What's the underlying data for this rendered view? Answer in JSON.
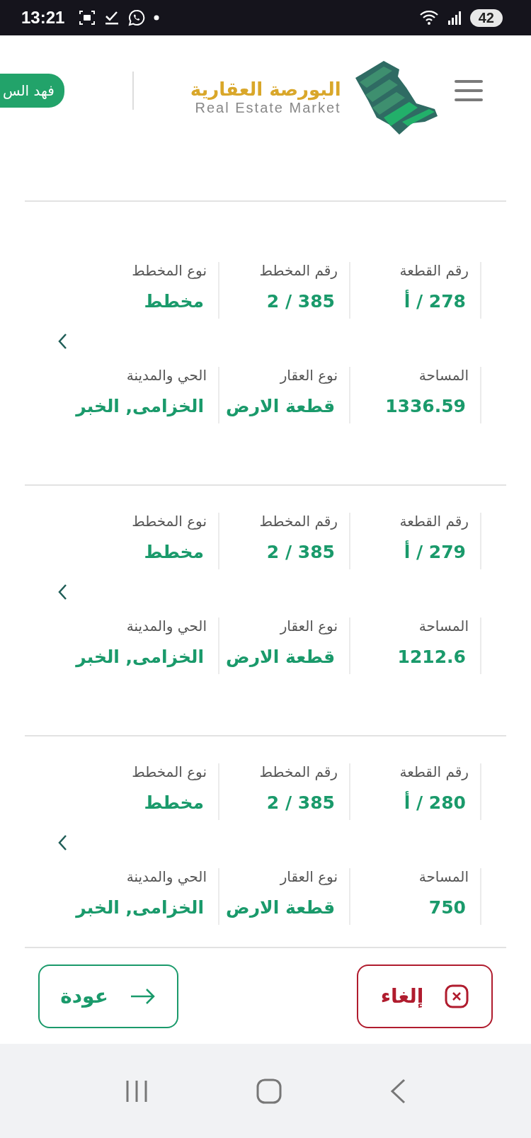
{
  "status_bar": {
    "time": "13:21",
    "battery": "42"
  },
  "header": {
    "user_button": "فهد الس",
    "logo_arabic": "البورصة العقارية",
    "logo_english": "Real Estate Market"
  },
  "properties": [
    {
      "fields": [
        {
          "label": "رقم القطعة",
          "value": "278 / أ"
        },
        {
          "label": "رقم المخطط",
          "value": "385 / 2"
        },
        {
          "label": "نوع المخطط",
          "value": "مخطط"
        },
        {
          "label": "المساحة",
          "value": "1336.59"
        },
        {
          "label": "نوع العقار",
          "value": "قطعة الارض"
        },
        {
          "label": "الحي والمدينة",
          "value": "الخزامى, الخبر"
        }
      ]
    },
    {
      "fields": [
        {
          "label": "رقم القطعة",
          "value": "279 / أ"
        },
        {
          "label": "رقم المخطط",
          "value": "385 / 2"
        },
        {
          "label": "نوع المخطط",
          "value": "مخطط"
        },
        {
          "label": "المساحة",
          "value": "1212.6"
        },
        {
          "label": "نوع العقار",
          "value": "قطعة الارض"
        },
        {
          "label": "الحي والمدينة",
          "value": "الخزامى, الخبر"
        }
      ]
    },
    {
      "fields": [
        {
          "label": "رقم القطعة",
          "value": "280 / أ"
        },
        {
          "label": "رقم المخطط",
          "value": "385 / 2"
        },
        {
          "label": "نوع المخطط",
          "value": "مخطط"
        },
        {
          "label": "المساحة",
          "value": "750"
        },
        {
          "label": "نوع العقار",
          "value": "قطعة الارض"
        },
        {
          "label": "الحي والمدينة",
          "value": "الخزامى, الخبر"
        }
      ]
    }
  ],
  "buttons": {
    "cancel": "إلغاء",
    "back": "عودة"
  }
}
